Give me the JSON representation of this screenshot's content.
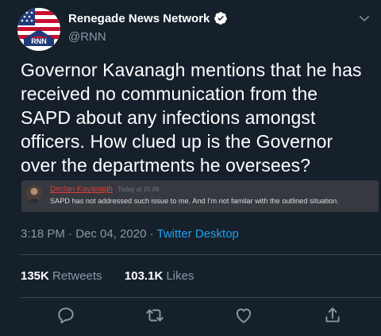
{
  "account": {
    "name": "Renegade News Network",
    "handle": "@RNN",
    "avatar_text": "RNN",
    "verified_icon": "verified-badge-icon"
  },
  "tweet": {
    "text": "Governor Kavanagh mentions that he has received no communication from the SAPD about any infections amongst officers. How clued up is the Governor over the departments he oversees?"
  },
  "embed": {
    "username": "Declan Kavanagh",
    "timestamp": "Today at 15:09",
    "message": "SAPD has not addressed such issue to me. And I'm not familar with the outlined situation."
  },
  "meta": {
    "time": "3:18 PM",
    "separator": " · ",
    "date": "Dec 04, 2020",
    "source": "Twitter Desktop"
  },
  "stats": {
    "retweets_count": "135K",
    "retweets_label": "Retweets",
    "likes_count": "103.1K",
    "likes_label": "Likes"
  },
  "actions": [
    "reply-icon",
    "retweet-icon",
    "like-icon",
    "share-icon"
  ],
  "colors": {
    "background": "#15202b",
    "accent": "#1da1f2",
    "secondary_text": "#8899a6",
    "embed_background": "#36393f",
    "embed_username": "#e13c3c"
  }
}
